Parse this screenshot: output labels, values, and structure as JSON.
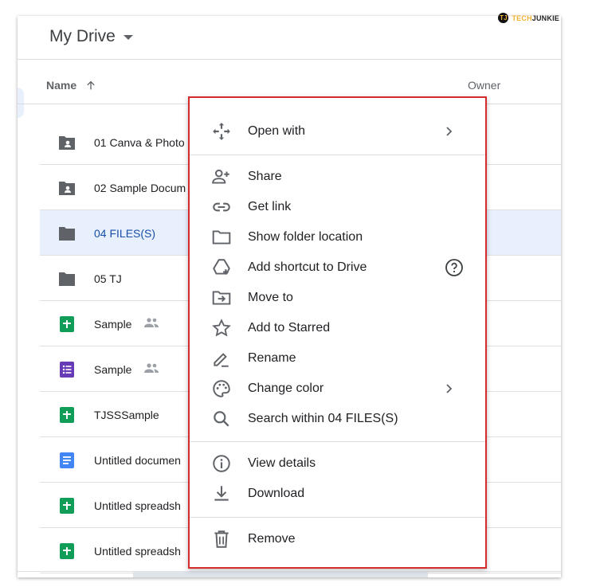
{
  "watermark": {
    "badge": "TJ",
    "text_a": "TECH",
    "text_b": "JUNKIE"
  },
  "header": {
    "title": "My Drive"
  },
  "columns": {
    "name": "Name",
    "owner": "Owner"
  },
  "files": [
    {
      "name": "01 Canva & Photo",
      "icon": "shared-folder-icon",
      "shared": false
    },
    {
      "name": "02 Sample Docum",
      "icon": "shared-folder-icon",
      "shared": false
    },
    {
      "name": "04 FILES(S)",
      "icon": "folder-icon",
      "shared": false,
      "selected": true
    },
    {
      "name": "05 TJ",
      "icon": "folder-icon",
      "shared": false
    },
    {
      "name": "Sample",
      "icon": "sheets-icon",
      "shared": true
    },
    {
      "name": "Sample",
      "icon": "forms-icon",
      "shared": true
    },
    {
      "name": "TJSSSample",
      "icon": "sheets-icon",
      "shared": false
    },
    {
      "name": "Untitled documen",
      "icon": "docs-icon",
      "shared": false
    },
    {
      "name": "Untitled spreadsh",
      "icon": "sheets-icon",
      "shared": false
    },
    {
      "name": "Untitled spreadsh",
      "icon": "sheets-icon",
      "shared": false
    }
  ],
  "colors": {
    "accent_border": "#d52b2b",
    "selected_row": "#e8f0fe",
    "sheets": "#0f9d58",
    "docs": "#4285f4",
    "forms": "#673ab7"
  },
  "menu": {
    "open_with": "Open with",
    "share": "Share",
    "get_link": "Get link",
    "show_folder_location": "Show folder location",
    "add_shortcut": "Add shortcut to Drive",
    "move_to": "Move to",
    "add_starred": "Add to Starred",
    "rename": "Rename",
    "change_color": "Change color",
    "search_within": "Search within 04 FILES(S)",
    "view_details": "View details",
    "download": "Download",
    "remove": "Remove"
  }
}
